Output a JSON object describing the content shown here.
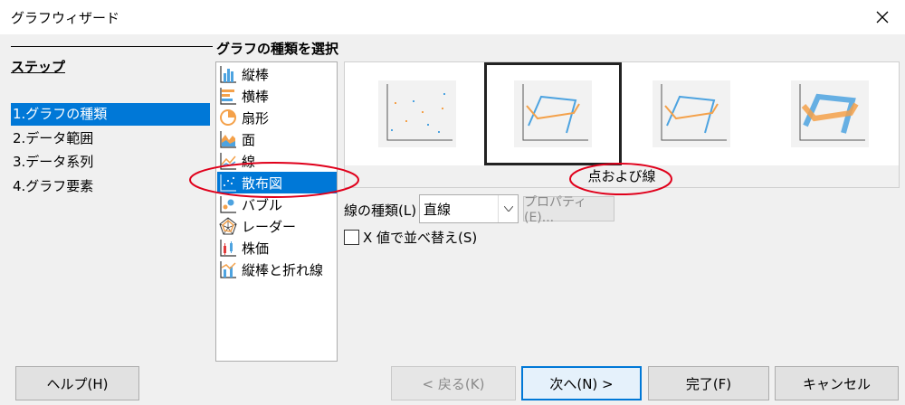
{
  "window": {
    "title": "グラフウィザード"
  },
  "steps": {
    "heading": "ステップ",
    "items": [
      {
        "label": "1.グラフの種類",
        "selected": true
      },
      {
        "label": "2.データ範囲",
        "selected": false
      },
      {
        "label": "3.データ系列",
        "selected": false
      },
      {
        "label": "4.グラフ要素",
        "selected": false
      }
    ]
  },
  "main": {
    "section_title": "グラフの種類を選択",
    "chart_types": [
      {
        "label": "縦棒",
        "icon": "column-chart-icon"
      },
      {
        "label": "横棒",
        "icon": "bar-chart-icon"
      },
      {
        "label": "扇形",
        "icon": "pie-chart-icon"
      },
      {
        "label": "面",
        "icon": "area-chart-icon"
      },
      {
        "label": "線",
        "icon": "line-chart-icon"
      },
      {
        "label": "散布図",
        "icon": "scatter-chart-icon",
        "selected": true
      },
      {
        "label": "バブル",
        "icon": "bubble-chart-icon"
      },
      {
        "label": "レーダー",
        "icon": "radar-chart-icon"
      },
      {
        "label": "株価",
        "icon": "stock-chart-icon"
      },
      {
        "label": "縦棒と折れ線",
        "icon": "column-and-line-chart-icon"
      }
    ],
    "subtype_caption": "点および線",
    "line_type_label": "線の種類(L)",
    "line_type_value": "直線",
    "properties_button": "プロパティ(E)...",
    "sort_by_x_label": "X 値で並べ替え(S)",
    "sort_by_x_checked": false
  },
  "buttons": {
    "help": "ヘルプ(H)",
    "back": "< 戻る(K)",
    "next": "次へ(N) >",
    "finish": "完了(F)",
    "cancel": "キャンセル"
  },
  "colors": {
    "selection": "#0078d7",
    "annotation": "#e0001b",
    "series_orange": "#f4a14a",
    "series_blue": "#4da3e0"
  }
}
